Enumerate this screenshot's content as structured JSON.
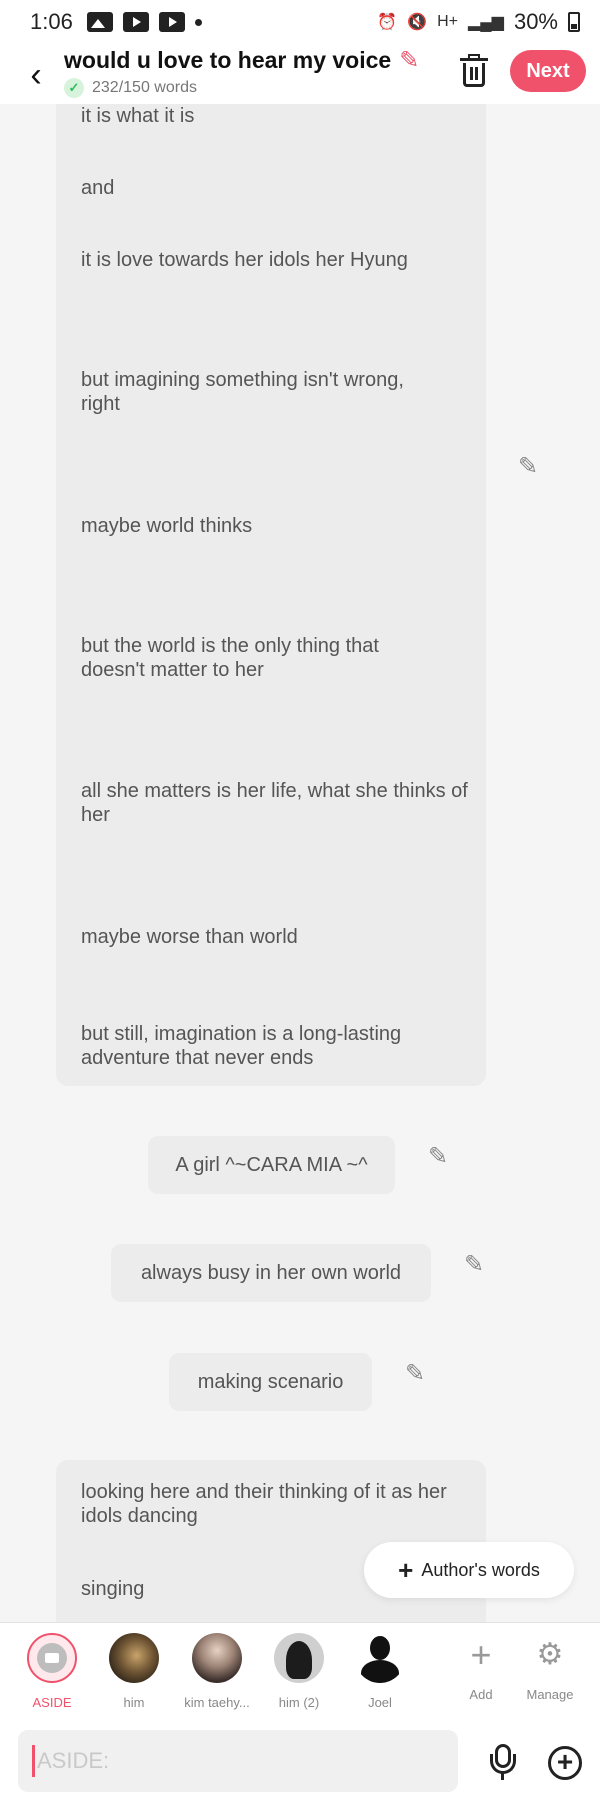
{
  "status_bar": {
    "time": "1:06",
    "battery": "30%",
    "network": "H+"
  },
  "header": {
    "title": "would u love to hear my voice",
    "word_count": "232/150 words",
    "next_label": "Next"
  },
  "story_lines": [
    "it is what it is",
    "and",
    "it is love towards her idols her Hyung",
    "but imagining something isn't wrong, right",
    "maybe world thinks",
    "but the world is the only thing that doesn't matter to her",
    "all she matters is her life, what she thinks of her",
    "maybe worse than world",
    "but still, imagination is a long-lasting adventure that never ends"
  ],
  "narration_bubbles": [
    "A girl ^~CARA MIA ~^",
    "always busy in her own world",
    "making scenario"
  ],
  "bottom_lines": [
    "looking here and their thinking of it as her idols dancing",
    "singing"
  ],
  "author_words_label": "Author's words",
  "characters": [
    {
      "name": "ASIDE",
      "selected": true
    },
    {
      "name": "him"
    },
    {
      "name": "kim taehy..."
    },
    {
      "name": "him (2)"
    },
    {
      "name": "Joel"
    }
  ],
  "tools": {
    "add": "Add",
    "manage": "Manage"
  },
  "input": {
    "placeholder": "ASIDE:"
  },
  "colors": {
    "accent": "#f0526b",
    "bubble": "#ececec",
    "background": "#f5f5f5"
  }
}
